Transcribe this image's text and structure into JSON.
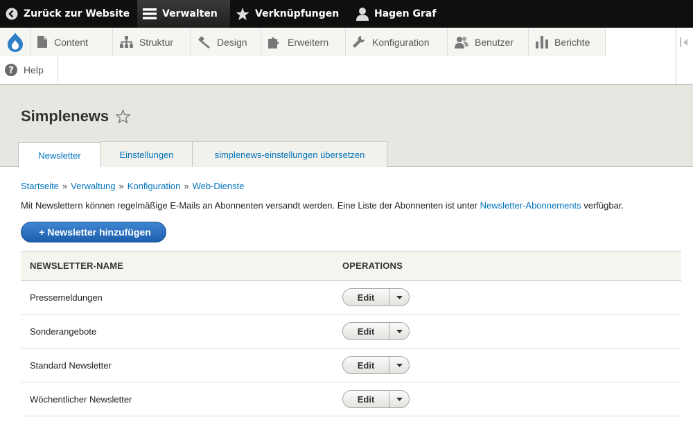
{
  "toolbar": {
    "back_label": "Zurück zur Website",
    "manage_label": "Verwalten",
    "shortcuts_label": "Verknüpfungen",
    "user_label": "Hagen Graf"
  },
  "tray": {
    "items": [
      {
        "label": "Content",
        "icon": "page-icon"
      },
      {
        "label": "Struktur",
        "icon": "sitemap-icon"
      },
      {
        "label": "Design",
        "icon": "paintbrush-icon"
      },
      {
        "label": "Erweitern",
        "icon": "puzzle-icon"
      },
      {
        "label": "Konfiguration",
        "icon": "wrench-icon"
      },
      {
        "label": "Benutzer",
        "icon": "people-icon"
      },
      {
        "label": "Berichte",
        "icon": "bar-chart-icon"
      }
    ],
    "help_label": "Help"
  },
  "page": {
    "title": "Simplenews"
  },
  "tabs": [
    {
      "label": "Newsletter",
      "active": true
    },
    {
      "label": "Einstellungen",
      "active": false
    },
    {
      "label": "simplenews-einstellungen übersetzen",
      "active": false
    }
  ],
  "breadcrumb": {
    "items": [
      "Startseite",
      "Verwaltung",
      "Konfiguration",
      "Web-Dienste"
    ],
    "separator": "»"
  },
  "description": {
    "text_before": "Mit Newslettern können regelmäßige E-Mails an Abonnenten versandt werden. Eine Liste der Abonnenten ist unter ",
    "link_text": "Newsletter-Abonnements",
    "text_after": " verfügbar."
  },
  "add_button": {
    "plus": "+",
    "label": "Newsletter hinzufügen"
  },
  "table": {
    "headers": [
      "NEWSLETTER-NAME",
      "OPERATIONS"
    ],
    "rows": [
      {
        "name": "Pressemeldungen",
        "operation": "Edit"
      },
      {
        "name": "Sonderangebote",
        "operation": "Edit"
      },
      {
        "name": "Standard Newsletter",
        "operation": "Edit"
      },
      {
        "name": "Wöchentlicher Newsletter",
        "operation": "Edit"
      }
    ]
  },
  "colors": {
    "link": "#0074bd",
    "primary_button": "#2b6fbf",
    "toolbar_bg": "#0f0f0f",
    "header_bg": "#e7e6e0"
  }
}
